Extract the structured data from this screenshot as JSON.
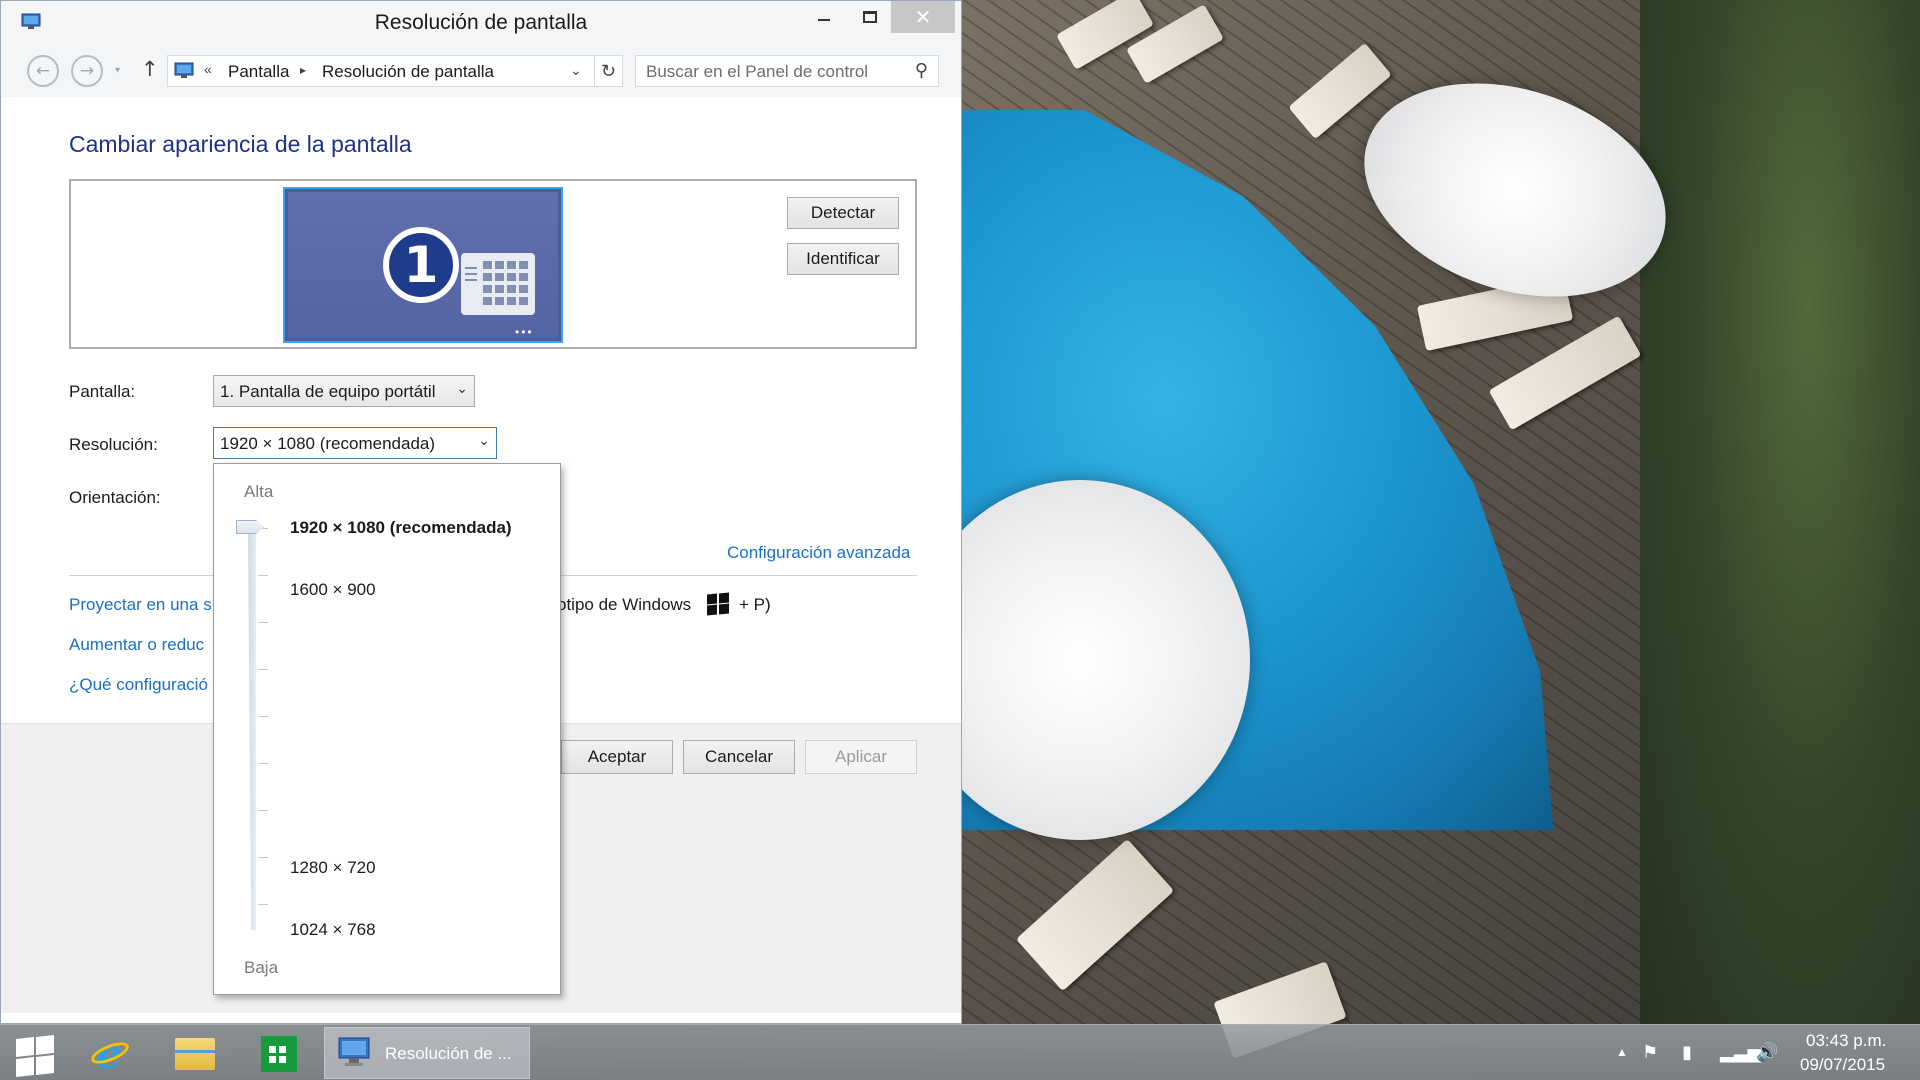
{
  "window": {
    "title": "Resolución de pantalla",
    "close_glyph": "✕"
  },
  "address_bar": {
    "back_glyph": "←",
    "forward_glyph": "→",
    "history_glyph": "▾",
    "up_glyph": "↑",
    "overflow_glyph": "«",
    "breadcrumb": [
      "Pantalla",
      "Resolución de pantalla"
    ],
    "separator_glyph": "▸",
    "dropdown_glyph": "⌄",
    "refresh_glyph": "↻",
    "search_placeholder": "Buscar en el Panel de control",
    "search_glyph": "⚲"
  },
  "content": {
    "heading": "Cambiar apariencia de la pantalla",
    "monitor_number": "1",
    "monitor_dots": "•••",
    "detect_button": "Detectar",
    "identify_button": "Identificar",
    "display_label": "Pantalla:",
    "display_value": "1. Pantalla de equipo portátil",
    "resolution_label": "Resolución:",
    "resolution_value": "1920 × 1080 (recomendada)",
    "orientation_label": "Orientación:",
    "combo_chevron": "⌄",
    "advanced_link": "Configuración avanzada",
    "link_project": "Proyectar en una s",
    "link_project_hint": "otipo de Windows",
    "link_project_hint2": "+ P)",
    "link_text_size": "Aumentar o reduc",
    "link_what_settings": "¿Qué configuració"
  },
  "footer": {
    "ok": "Aceptar",
    "cancel": "Cancelar",
    "apply": "Aplicar"
  },
  "resolution_dropdown": {
    "high_label": "Alta",
    "low_label": "Baja",
    "options": [
      "1920 × 1080 (recomendada)",
      "1600 × 900",
      "1280 × 720",
      "1024 × 768"
    ],
    "selected": "1920 × 1080 (recomendada)"
  },
  "taskbar": {
    "active_window_label": "Resolución de ...",
    "tray_chevron": "▲",
    "flag_glyph": "⚑",
    "power_glyph": "▮",
    "signal_glyph": "▂▃▅",
    "volume_glyph": "🔊",
    "time": "03:43 p.m.",
    "date": "09/07/2015"
  },
  "colors": {
    "accent_link": "#1c6fc4",
    "heading": "#1e3287",
    "monitor_fill": "#5464a4",
    "selection_border": "#3ba2f0"
  }
}
